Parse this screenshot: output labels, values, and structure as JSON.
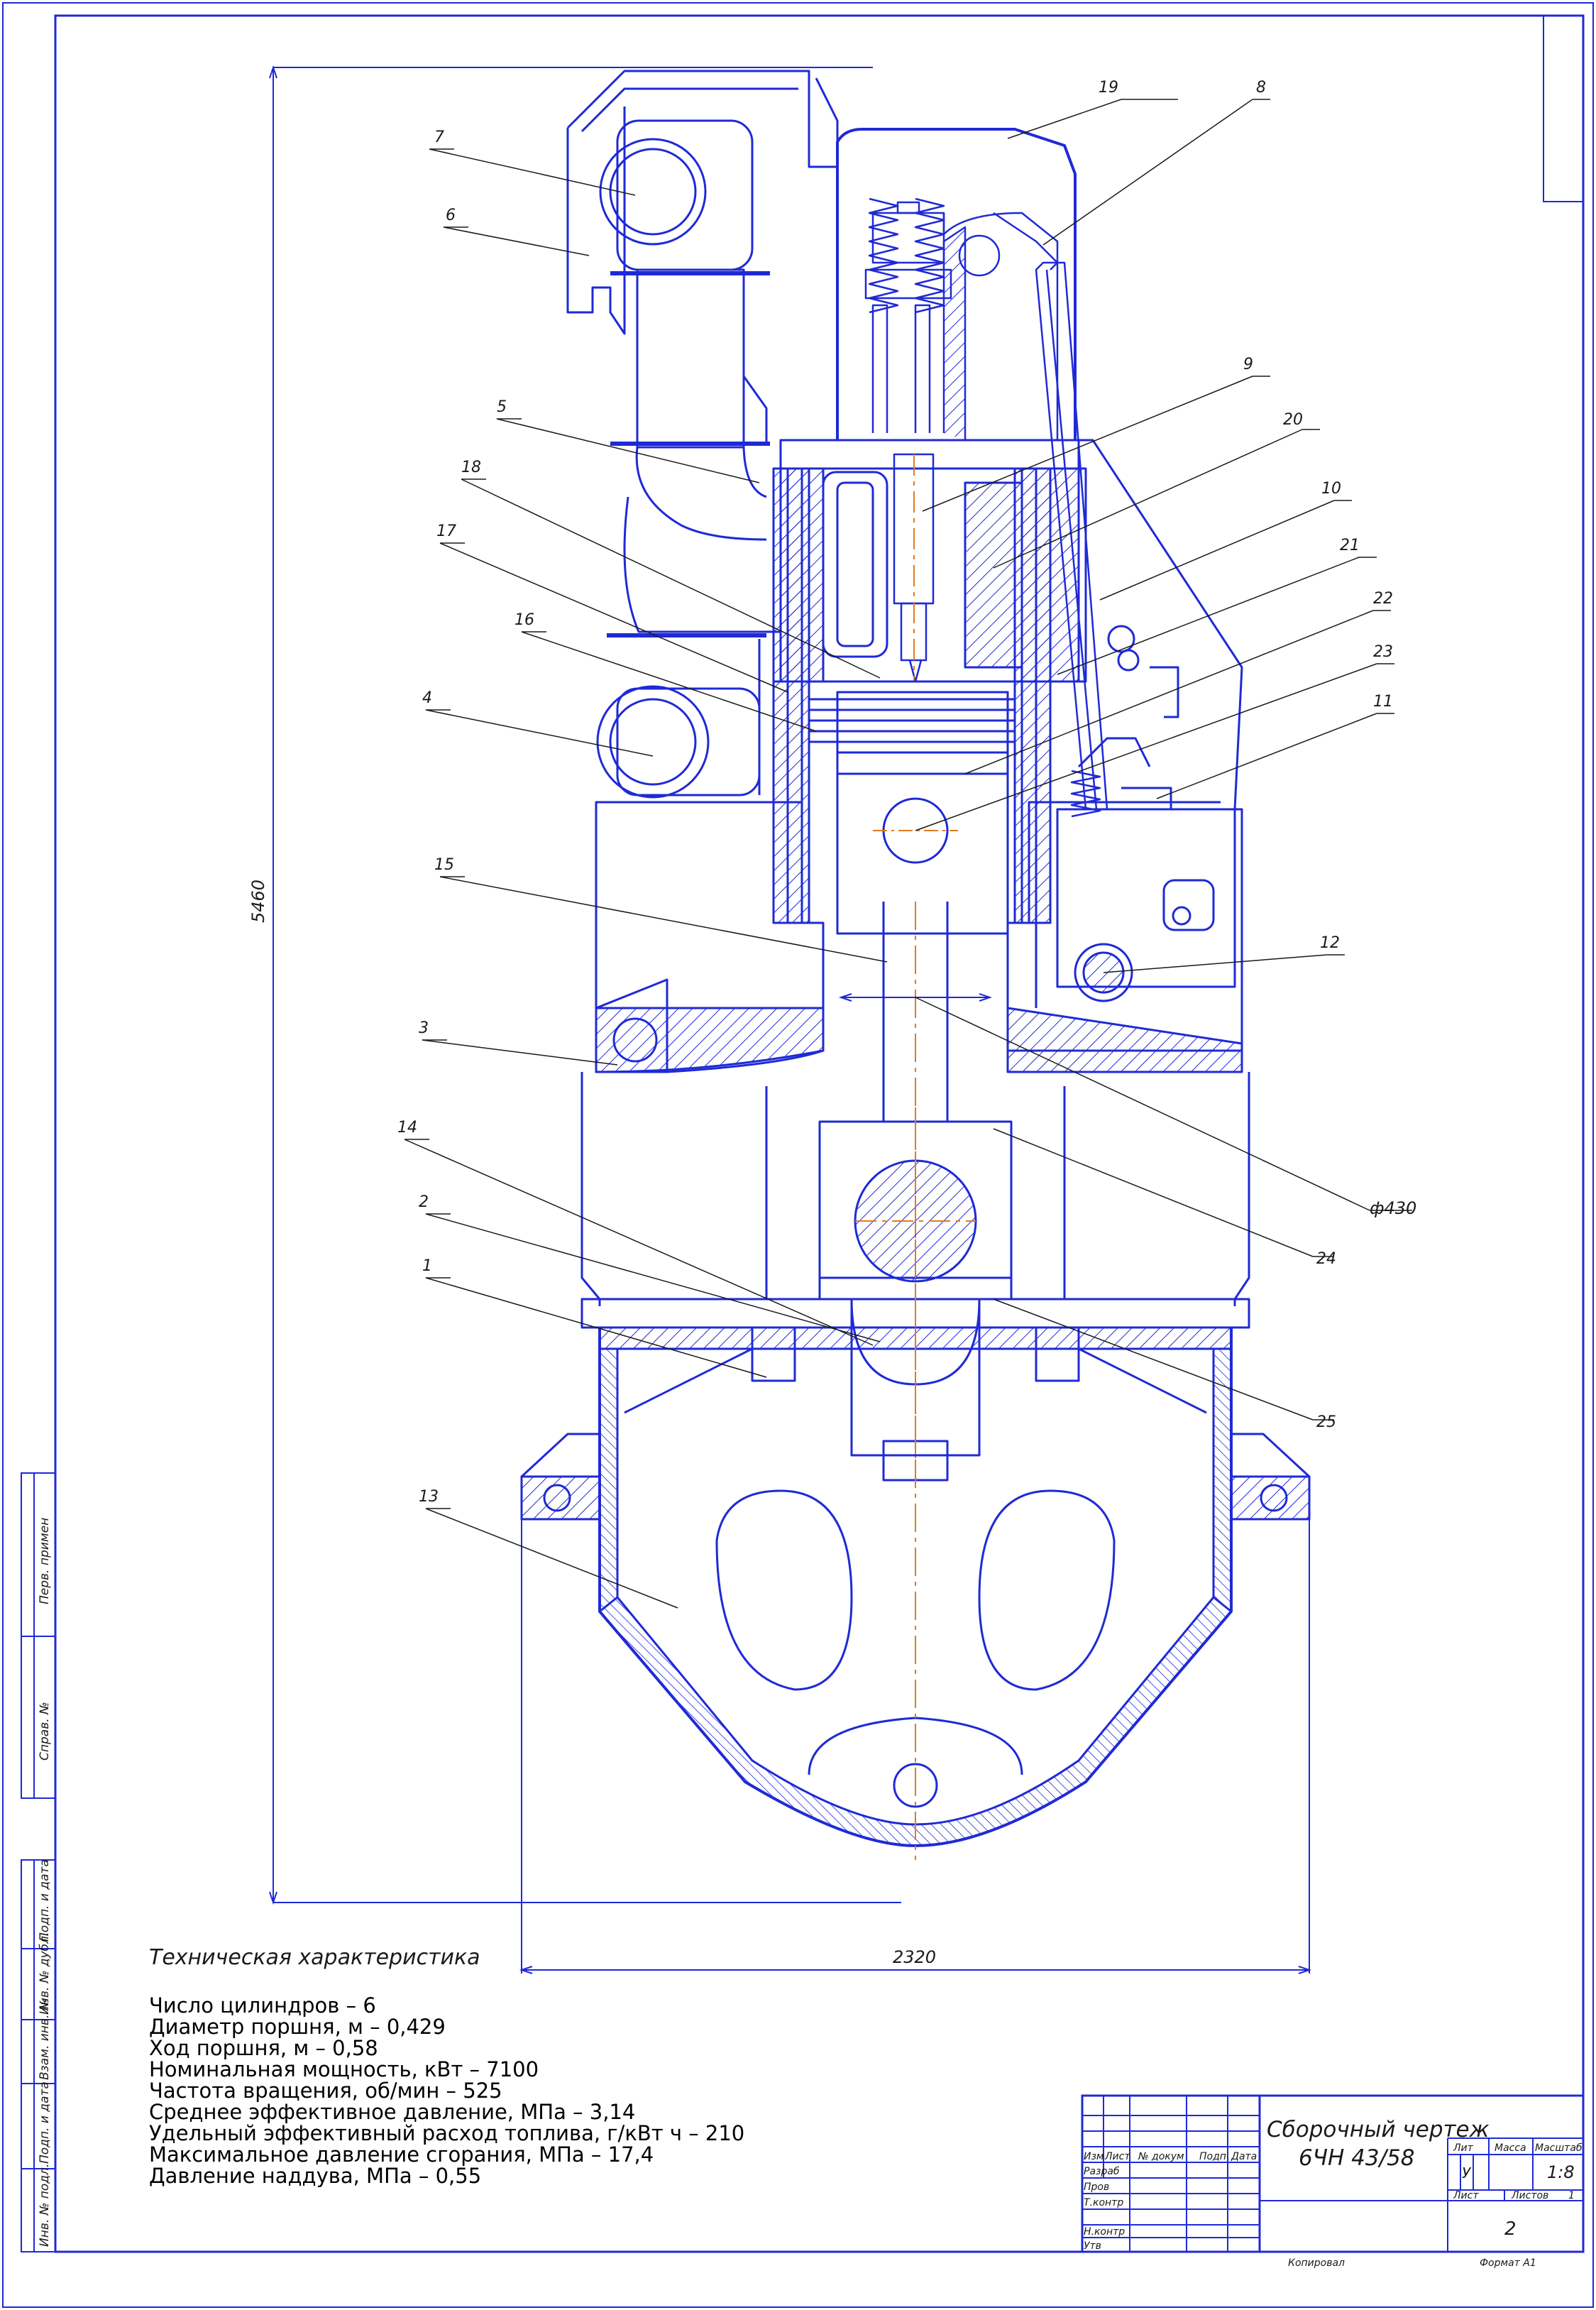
{
  "drawing": {
    "title_line1": "Сборочный чертеж",
    "title_line2": "6ЧН 43/58",
    "dimension_height": "5460",
    "dimension_width": "2320",
    "dimension_bore": "ф430",
    "callouts": [
      "19",
      "8",
      "7",
      "6",
      "5",
      "9",
      "20",
      "18",
      "10",
      "17",
      "21",
      "16",
      "22",
      "23",
      "4",
      "11",
      "15",
      "12",
      "3",
      "14",
      "24",
      "2",
      "1",
      "25",
      "13"
    ]
  },
  "specs": {
    "heading": "Техническая характеристика",
    "lines": [
      "Число цилиндров – 6",
      "Диаметр поршня, м – 0,429",
      "Ход поршня, м – 0,58",
      "Номинальная мощность, кВт – 7100",
      "Частота вращения, об/мин – 525",
      "Среднее эффективное давление, МПа – 3,14",
      "Удельный эффективный расход топлива, г/кВт ч – 210",
      "Максимальное давление сгорания, МПа – 17,4",
      "Давление наддува, МПа – 0,55"
    ]
  },
  "title_block": {
    "col_izm": "Изм",
    "col_list": "Лист",
    "col_doc": "№ докум",
    "col_podp": "Подп",
    "col_data": "Дата",
    "row_razrab": "Разраб",
    "row_prov": "Пров",
    "row_tkontr": "Т.контр",
    "row_nkontr": "Н.контр",
    "row_utv": "Утв",
    "lit_label": "Лит",
    "mass_label": "Масса",
    "scale_label": "Масштаб",
    "lit_value": "У",
    "scale_value": "1:8",
    "sheet_label": "Лист",
    "sheets_label": "Листов",
    "sheets_value": "1",
    "sheet_number": "2",
    "copied": "Копировал",
    "format": "Формат   А1"
  },
  "side_stamp": {
    "perv_primen": "Перв. примен",
    "sprav_no": "Справ. №",
    "podp_data_1": "Подп. и дата",
    "inv_dubl": "Инв. № дубл.",
    "vzam_inv": "Взам. инв. №",
    "podp_data_2": "Подп. и дата",
    "inv_podl": "Инв. № подл."
  },
  "colors": {
    "line": "#1f2ad6",
    "hatch": "#1f2ad6",
    "center": "#e07a1f",
    "frame": "#1f2ad6",
    "text": "#1a1a1a"
  }
}
